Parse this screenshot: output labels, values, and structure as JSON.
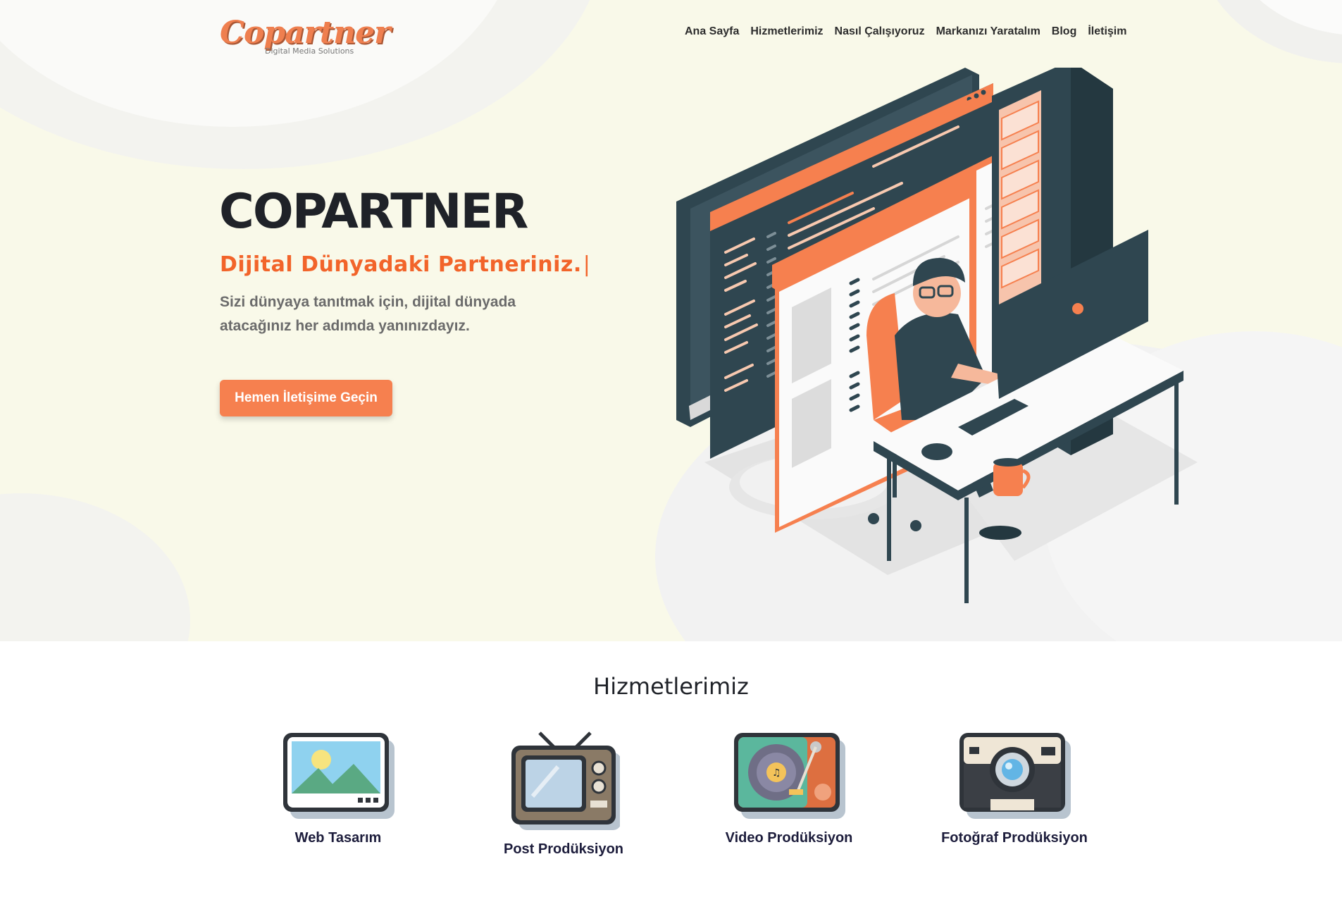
{
  "header": {
    "logo_text": "Copartner",
    "logo_tagline": "Digital Media Solutions",
    "nav": [
      {
        "label": "Ana Sayfa"
      },
      {
        "label": "Hizmetlerimiz"
      },
      {
        "label": "Nasıl Çalışıyoruz"
      },
      {
        "label": "Markanızı Yaratalım"
      },
      {
        "label": "Blog"
      },
      {
        "label": "İletişim"
      }
    ]
  },
  "hero": {
    "title": "COPARTNER",
    "tagline": "Dijital Dünyadaki Partneriniz.",
    "cursor": "|",
    "description_line1": "Sizi dünyaya tanıtmak için, dijital dünyada",
    "description_line2": "atacağınız her adımda yanınızdayız.",
    "cta_label": "Hemen İletişime Geçin"
  },
  "services": {
    "title": "Hizmetlerimiz",
    "items": [
      {
        "label": "Web Tasarım",
        "icon": "picture-frame-icon"
      },
      {
        "label": "Post Prodüksiyon",
        "icon": "retro-tv-icon"
      },
      {
        "label": "Video Prodüksiyon",
        "icon": "record-player-icon"
      },
      {
        "label": "Fotoğraf Prodüksiyon",
        "icon": "instant-camera-icon"
      }
    ]
  },
  "colors": {
    "accent": "#f2642a",
    "button": "#f6804f",
    "hero_background": "#f9f9e9",
    "dark": "#2f4650"
  }
}
